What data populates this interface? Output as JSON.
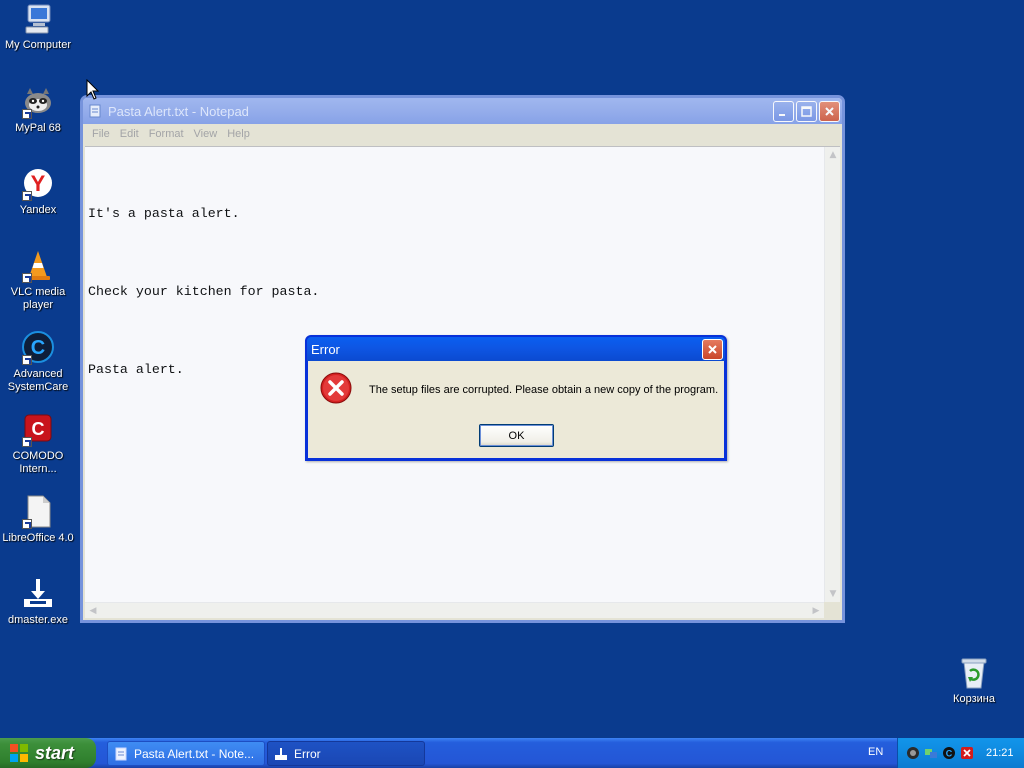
{
  "desktop": {
    "icons": [
      {
        "label": "My Computer"
      },
      {
        "label": "MyPal 68"
      },
      {
        "label": "Yandex"
      },
      {
        "label": "VLC media player"
      },
      {
        "label": "Advanced SystemCare"
      },
      {
        "label": "COMODO Intern..."
      },
      {
        "label": "LibreOffice 4.0"
      },
      {
        "label": "dmaster.exe"
      },
      {
        "label": "Корзина"
      }
    ]
  },
  "notepad": {
    "title": "Pasta Alert.txt - Notepad",
    "menu": [
      "File",
      "Edit",
      "Format",
      "View",
      "Help"
    ],
    "lines": [
      "It's a pasta alert.",
      "Check your kitchen for pasta.",
      "Pasta alert."
    ]
  },
  "dialog": {
    "title": "Error",
    "message": "The setup files are corrupted. Please obtain a new copy of the program.",
    "ok_label": "OK",
    "icon": "error-icon"
  },
  "taskbar": {
    "start_label": "start",
    "tasks": [
      {
        "label": "Pasta Alert.txt - Note..."
      },
      {
        "label": "Error"
      }
    ],
    "language": "EN",
    "clock": "21:21"
  },
  "colors": {
    "desktop": "#0a3b8e",
    "dialog_title": "#0a5ff0",
    "start_green": "#3c8f3a"
  }
}
